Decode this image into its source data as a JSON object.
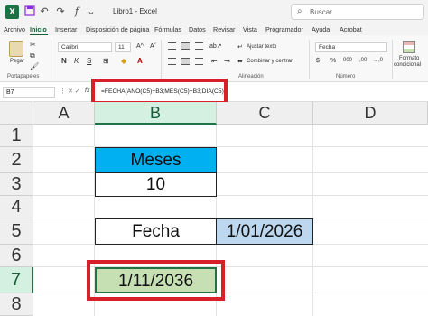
{
  "titlebar": {
    "app_logo": "X",
    "title": "Libro1 - Excel",
    "search_placeholder": "Buscar",
    "icons": [
      "save-icon",
      "undo-icon",
      "redo-icon",
      "function-icon",
      "chevron-down-icon"
    ]
  },
  "menu": {
    "tabs": [
      {
        "label": "Archivo"
      },
      {
        "label": "Inicio"
      },
      {
        "label": "Insertar"
      },
      {
        "label": "Disposición de página"
      },
      {
        "label": "Fórmulas"
      },
      {
        "label": "Datos"
      },
      {
        "label": "Revisar"
      },
      {
        "label": "Vista"
      },
      {
        "label": "Programador"
      },
      {
        "label": "Ayuda"
      },
      {
        "label": "Acrobat"
      }
    ],
    "active_tab": "Inicio"
  },
  "ribbon": {
    "paste_label": "Pegar",
    "clipboard_group": "Portapapeles",
    "font_name": "Calibri",
    "font_size": "11",
    "bold": "N",
    "italic": "K",
    "underline": "S",
    "grow_font": "A^",
    "shrink_font": "Aˇ",
    "wrap_text": "Ajustar texto",
    "merge_center": "Combinar y centrar",
    "alignment_group": "Alineación",
    "number_format": "Fecha",
    "currency": "$",
    "percent": "%",
    "thousands": "000",
    "decimals_up": ",00",
    "decimals_down": "→,0",
    "number_group": "Número",
    "conditional_format_line1": "Formato",
    "conditional_format_line2": "condicional"
  },
  "formula_bar": {
    "name_box": "B7",
    "fx_symbol": "fx",
    "formula": "=FECHA(AÑO(C5)+B3;MES(C5)+B3;DIA(C5))"
  },
  "grid": {
    "columns": [
      "A",
      "B",
      "C",
      "D"
    ],
    "rows": [
      "1",
      "2",
      "3",
      "4",
      "5",
      "6",
      "7",
      "8"
    ],
    "selected_column": "B",
    "selected_row": "7",
    "cells": {
      "B2": "Meses",
      "B3": "10",
      "B5": "Fecha",
      "C5": "1/01/2026",
      "B7": "1/11/2036"
    }
  },
  "colors": {
    "excel_green": "#217346",
    "header_blue": "#00b0f0",
    "date_blue": "#bdd7ee",
    "result_green": "#c6e0b4",
    "highlight_red": "#d7202a"
  }
}
